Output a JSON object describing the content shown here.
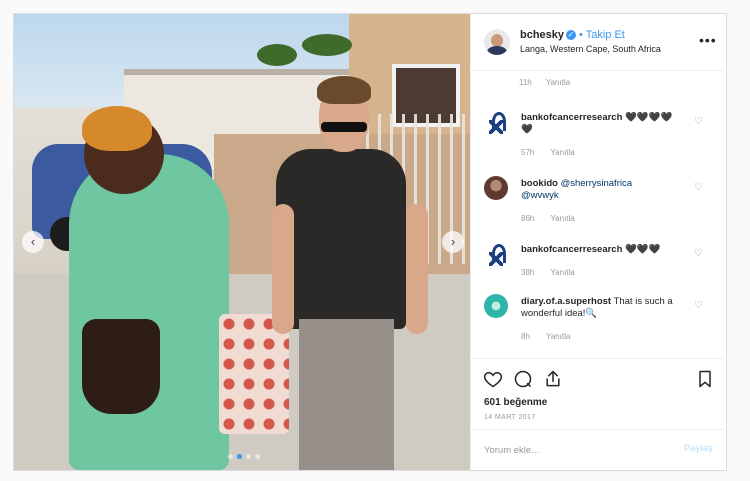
{
  "post": {
    "username": "bchesky",
    "separator": "•",
    "follow_label": "Takip Et",
    "location": "Langa, Western Cape, South Africa",
    "more_label": "•••"
  },
  "comments_meta_top": {
    "age": "11h",
    "reply": "Yanıtla"
  },
  "comments": [
    {
      "user": "bankofcancerresearch",
      "text": "🖤🖤🖤🖤",
      "text2": "🖤",
      "age": "57h",
      "reply": "Yanıtla"
    },
    {
      "user": "bookido",
      "mention": "@sherrysinafrica",
      "mention2": "@wvwyk",
      "age": "86h",
      "reply": "Yanıtla"
    },
    {
      "user": "bankofcancerresearch",
      "text": "🖤🖤🖤",
      "age": "38h",
      "reply": "Yanıtla"
    },
    {
      "user": "diary.of.a.superhost",
      "text": "That is such a wonderful idea!🔍",
      "age": "8h",
      "reply": "Yanıtla"
    }
  ],
  "likes": "601 beğenme",
  "date": "14 MART 2017",
  "comment_input": {
    "placeholder": "Yorum ekle...",
    "value": ""
  },
  "post_button": "Paylaş",
  "colors": {
    "accent": "#3897f0",
    "ribbon": "#1d3f80"
  }
}
